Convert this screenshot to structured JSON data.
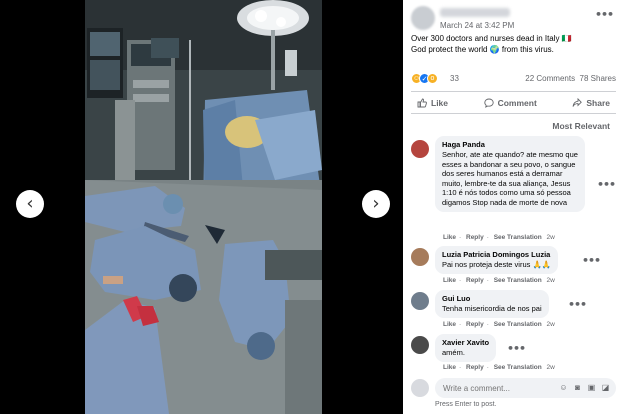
{
  "post": {
    "time": "March 24 at 3:42 PM",
    "text_line1": "Over 300 doctors and nurses dead in Italy 🇮🇹",
    "text_line2": "God protect the world 🌍 from this virus.",
    "reaction_count": "33",
    "comments_count": "22 Comments",
    "shares_count": "78 Shares"
  },
  "actions": {
    "like": "Like",
    "comment": "Comment",
    "share": "Share"
  },
  "sort_label": "Most Relevant",
  "comments": [
    {
      "name": "Haga Panda",
      "text": "Senhor, ate ate quando? ate mesmo que esses a bandonar a seu povo, o sangue dos seres humanos está a derramar muito, lembre-te da sua aliança, Jesus 1:10 é nós todos como uma só pessoa digamos Stop nada de morte de nova",
      "like": "Like",
      "reply": "Reply",
      "translation": "See Translation",
      "age": "2w",
      "avatar_color": "#b5453e"
    },
    {
      "name": "Luzia Patricia Domingos Luzia",
      "text": "Pai nos proteja deste virus 🙏🙏",
      "like": "Like",
      "reply": "Reply",
      "translation": "See Translation",
      "age": "2w",
      "avatar_color": "#a67b5b"
    },
    {
      "name": "Gui Luo",
      "text": "Tenha misericordia de nos pai",
      "like": "Like",
      "reply": "Reply",
      "translation": "See Translation",
      "age": "2w",
      "avatar_color": "#6f7d8c"
    },
    {
      "name": "Xavier Xavito",
      "text": "amém.",
      "like": "Like",
      "reply": "Reply",
      "translation": "See Translation",
      "age": "2w",
      "avatar_color": "#4a4a4a"
    }
  ],
  "composer": {
    "placeholder": "Write a comment...",
    "hint": "Press Enter to post."
  },
  "icons": {
    "prev": "chevron-left-icon",
    "next": "chevron-right-icon",
    "more": "more-options-icon",
    "like": "thumbs-up-icon",
    "comment": "comment-icon",
    "share": "share-icon"
  },
  "colors": {
    "accent": "#1877f2",
    "muted": "#65676b",
    "bubble": "#f0f2f5"
  }
}
